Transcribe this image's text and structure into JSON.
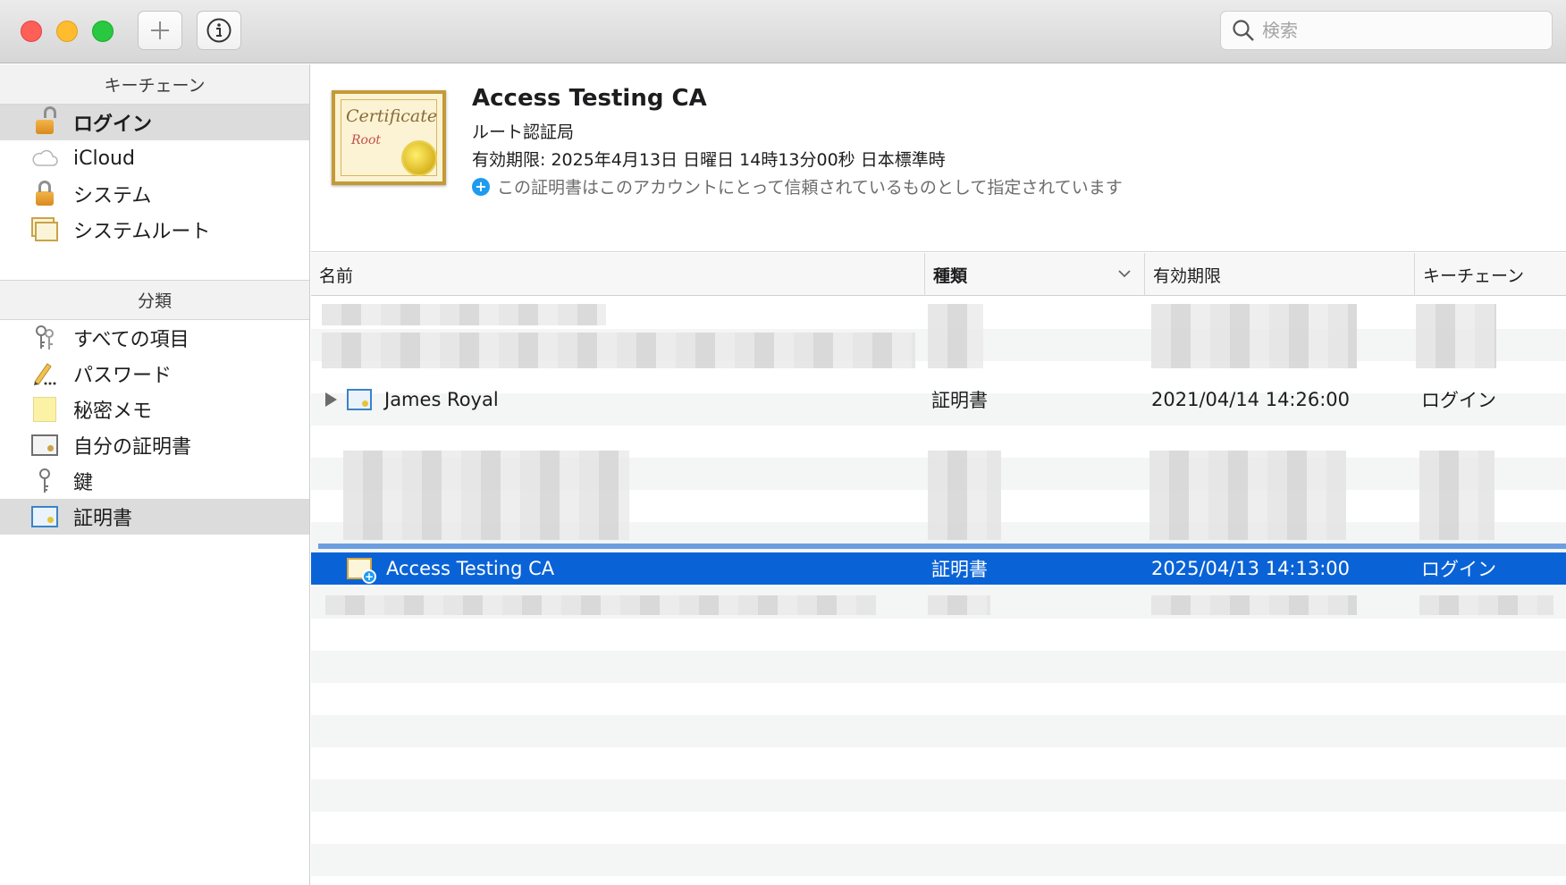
{
  "toolbar": {
    "add_icon": "plus-icon",
    "info_icon": "info-icon",
    "search": {
      "placeholder": "検索",
      "value": ""
    }
  },
  "sidebar": {
    "keychains_header": "キーチェーン",
    "keychains": [
      {
        "label": "ログイン",
        "icon": "lock-open-icon",
        "selected": true
      },
      {
        "label": "iCloud",
        "icon": "cloud-icon",
        "selected": false
      },
      {
        "label": "システム",
        "icon": "lock-icon",
        "selected": false
      },
      {
        "label": "システムルート",
        "icon": "certificates-icon",
        "selected": false
      }
    ],
    "categories_header": "分類",
    "categories": [
      {
        "label": "すべての項目",
        "icon": "keys-icon",
        "selected": false
      },
      {
        "label": "パスワード",
        "icon": "pencil-icon",
        "selected": false
      },
      {
        "label": "秘密メモ",
        "icon": "note-icon",
        "selected": false
      },
      {
        "label": "自分の証明書",
        "icon": "my-certificate-icon",
        "selected": false
      },
      {
        "label": "鍵",
        "icon": "key-icon",
        "selected": false
      },
      {
        "label": "証明書",
        "icon": "certificate-icon",
        "selected": true
      }
    ]
  },
  "detail": {
    "cert_script_top": "Certificate",
    "cert_script_bottom": "Root",
    "title": "Access Testing CA",
    "subtitle": "ルート認証局",
    "expiry": "有効期限: 2025年4月13日 日曜日 14時13分00秒 日本標準時",
    "trust_badge": "+",
    "trust_text": "この証明書はこのアカウントにとって信頼されているものとして指定されています"
  },
  "table": {
    "columns": {
      "name": "名前",
      "kind": "種類",
      "expires": "有効期限",
      "keychain": "キーチェーン"
    },
    "rows": [
      {
        "name": "James Royal",
        "kind": "証明書",
        "expires": "2021/04/14 14:26:00",
        "keychain": "ログイン",
        "selected": false
      },
      {
        "name": "Access Testing CA",
        "kind": "証明書",
        "expires": "2025/04/13 14:13:00",
        "keychain": "ログイン",
        "selected": true,
        "trust_badge": "+"
      }
    ]
  },
  "colors": {
    "selection": "#0a63d6",
    "drop_indicator": "#6b9ee0",
    "trust_badge": "#1d9bf0"
  }
}
